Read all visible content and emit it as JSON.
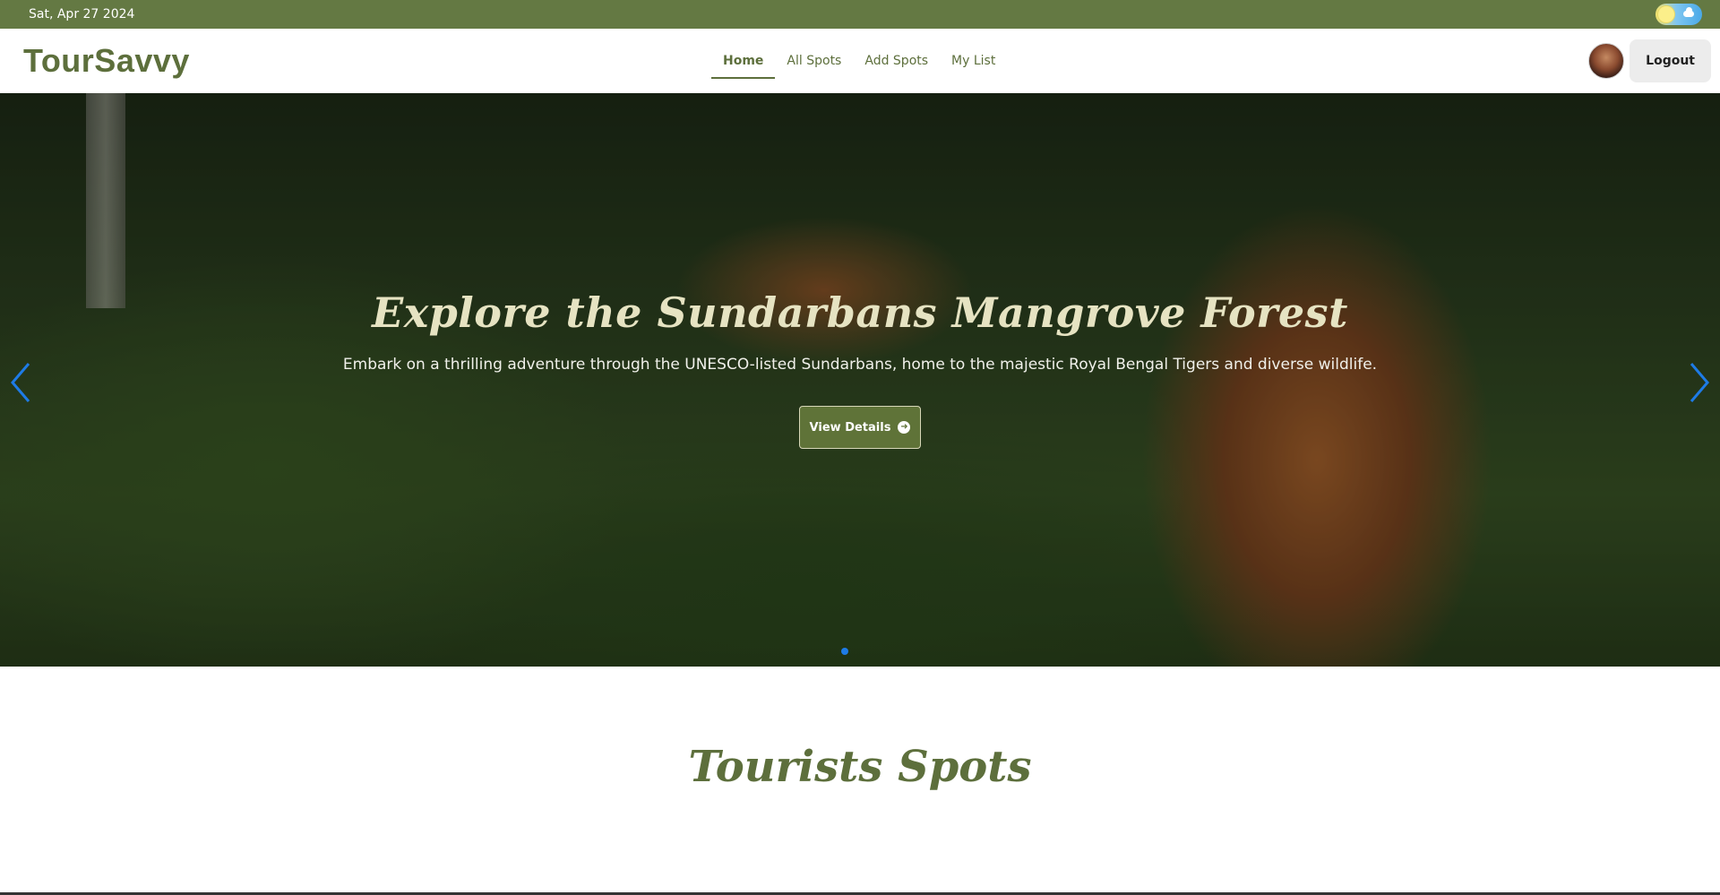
{
  "topbar": {
    "date": "Sat, Apr 27 2024",
    "theme_toggle_icon": "sun-cloud-toggle-icon"
  },
  "navbar": {
    "logo": "TourSavvy",
    "links": [
      {
        "label": "Home",
        "active": true
      },
      {
        "label": "All Spots",
        "active": false
      },
      {
        "label": "Add Spots",
        "active": false
      },
      {
        "label": "My List",
        "active": false
      }
    ],
    "logout_label": "Logout"
  },
  "hero": {
    "title": "Explore the Sundarbans Mangrove Forest",
    "subtitle": "Embark on a thrilling adventure through the UNESCO-listed Sundarbans, home to the majestic Royal Bengal Tigers and diverse wildlife.",
    "button_label": "View Details",
    "button_icon": "arrow-circle-right-icon",
    "prev_icon": "chevron-left-icon",
    "next_icon": "chevron-right-icon",
    "active_slide": 1,
    "accent_color": "#1e7be6"
  },
  "section": {
    "title": "Tourists Spots"
  },
  "colors": {
    "brand": "#647943",
    "brand_text": "#5d6f3c"
  }
}
